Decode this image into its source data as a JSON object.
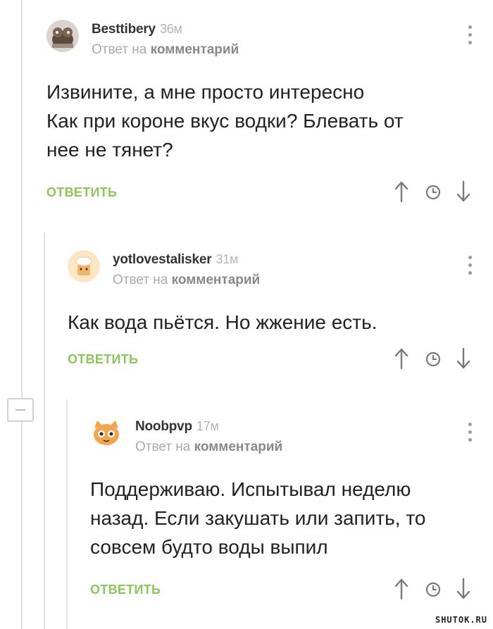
{
  "comments": [
    {
      "author": "Besttibery",
      "time": "36м",
      "reply_prefix": "Ответ на",
      "reply_link": "комментарий",
      "text": "Извините, а мне просто интересно\nКак при короне вкус водки? Блевать от\nнее не тянет?",
      "reply_label": "ОТВЕТИТЬ"
    },
    {
      "author": "yotlovestalisker",
      "time": "31м",
      "reply_prefix": "Ответ на",
      "reply_link": "комментарий",
      "text": "Как вода пьётся. Но жжение есть.",
      "reply_label": "ОТВЕТИТЬ"
    },
    {
      "author": "Noobpvp",
      "time": "17м",
      "reply_prefix": "Ответ на",
      "reply_link": "комментарий",
      "text": "Поддерживаю. Испытывал неделю\nназад. Если закушать или запить, то\nсовсем будто воды выпил",
      "reply_label": "ОТВЕТИТЬ"
    }
  ],
  "icons": {
    "upvote": "arrow-up-icon",
    "save": "clock-icon",
    "downvote": "arrow-down-icon",
    "menu": "more-vertical-icon",
    "collapse": "minus-icon"
  },
  "colors": {
    "accent_green": "#8ac858",
    "thread_line": "#e3e3e3",
    "icon_gray": "#7a7a7a"
  },
  "watermark": "SHUTOK.RU"
}
